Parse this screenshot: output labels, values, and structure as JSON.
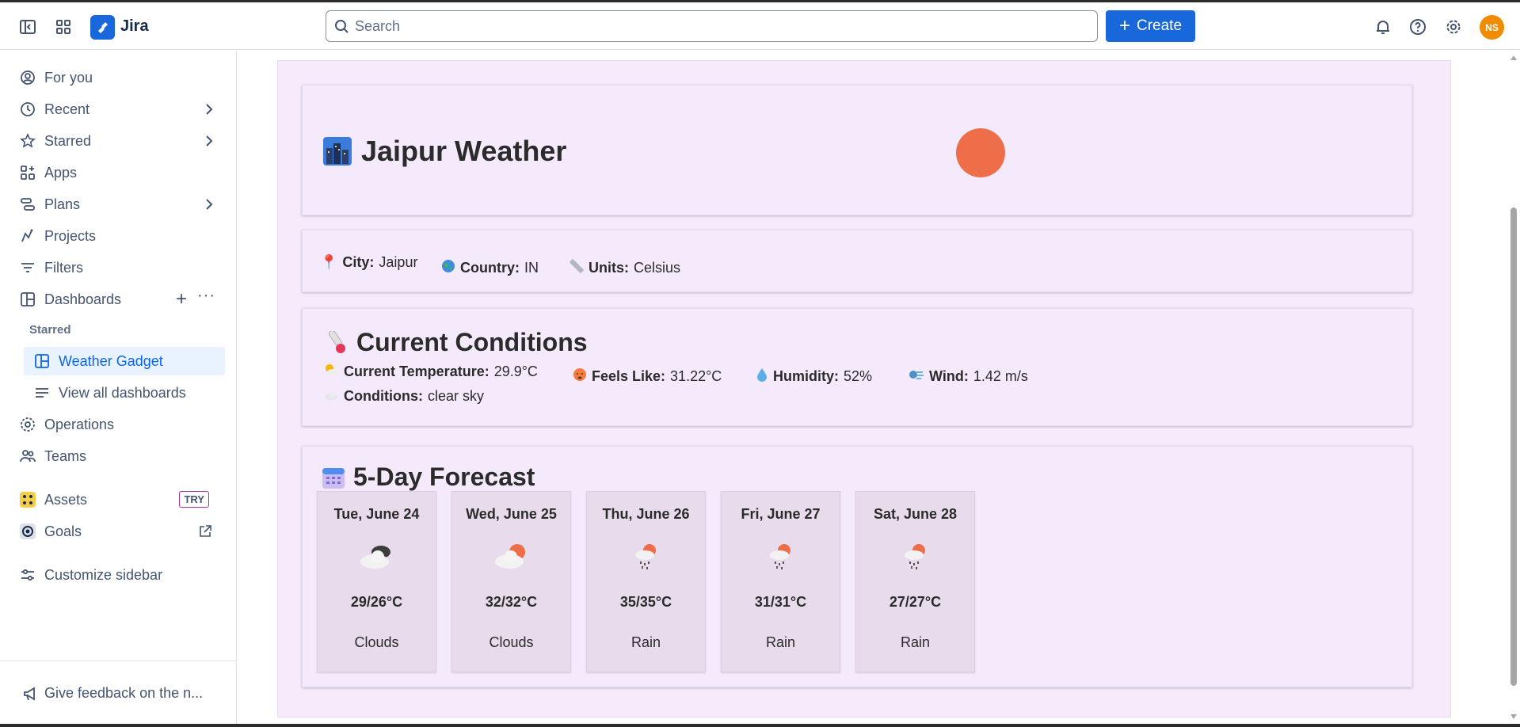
{
  "header": {
    "brand": "Jira",
    "search_placeholder": "Search",
    "create_label": "Create",
    "avatar_initials": "NS"
  },
  "sidebar": {
    "items": [
      {
        "label": "For you",
        "icon": "person-circle-icon"
      },
      {
        "label": "Recent",
        "icon": "clock-icon"
      },
      {
        "label": "Starred",
        "icon": "star-icon"
      },
      {
        "label": "Apps",
        "icon": "apps-icon"
      },
      {
        "label": "Plans",
        "icon": "plans-icon"
      },
      {
        "label": "Projects",
        "icon": "projects-icon"
      },
      {
        "label": "Filters",
        "icon": "filter-icon"
      },
      {
        "label": "Dashboards",
        "icon": "dashboard-icon"
      }
    ],
    "starred_heading": "Starred",
    "active_item": "Weather Gadget",
    "view_all": "View all dashboards",
    "operations": "Operations",
    "teams": "Teams",
    "assets": "Assets",
    "assets_badge": "TRY",
    "goals": "Goals",
    "customize": "Customize sidebar",
    "feedback": "Give feedback on the n..."
  },
  "gadget": {
    "title": "Jaipur Weather",
    "info": {
      "city_label": "City:",
      "city": "Jaipur",
      "country_label": "Country:",
      "country": "IN",
      "units_label": "Units:",
      "units": "Celsius"
    },
    "current": {
      "heading": "Current Conditions",
      "temp_label": "Current Temperature:",
      "temp": "29.9°C",
      "conditions_label": "Conditions:",
      "conditions": "clear sky",
      "feels_label": "Feels Like:",
      "feels": "31.22°C",
      "humidity_label": "Humidity:",
      "humidity": "52%",
      "wind_label": "Wind:",
      "wind": "1.42 m/s"
    },
    "forecast": {
      "heading": "5-Day Forecast",
      "days": [
        {
          "date": "Tue, June 24",
          "temp": "29/26°C",
          "cond": "Clouds",
          "icon": "clouds-icon"
        },
        {
          "date": "Wed, June 25",
          "temp": "32/32°C",
          "cond": "Clouds",
          "icon": "sun-cloud-icon"
        },
        {
          "date": "Thu, June 26",
          "temp": "35/35°C",
          "cond": "Rain",
          "icon": "rain-icon"
        },
        {
          "date": "Fri, June 27",
          "temp": "31/31°C",
          "cond": "Rain",
          "icon": "rain-icon"
        },
        {
          "date": "Sat, June 28",
          "temp": "27/27°C",
          "cond": "Rain",
          "icon": "rain-icon"
        }
      ]
    }
  },
  "colors": {
    "accent": "#1868db",
    "gadget_bg": "#f7ebfb",
    "sun": "#ee6e4a"
  }
}
